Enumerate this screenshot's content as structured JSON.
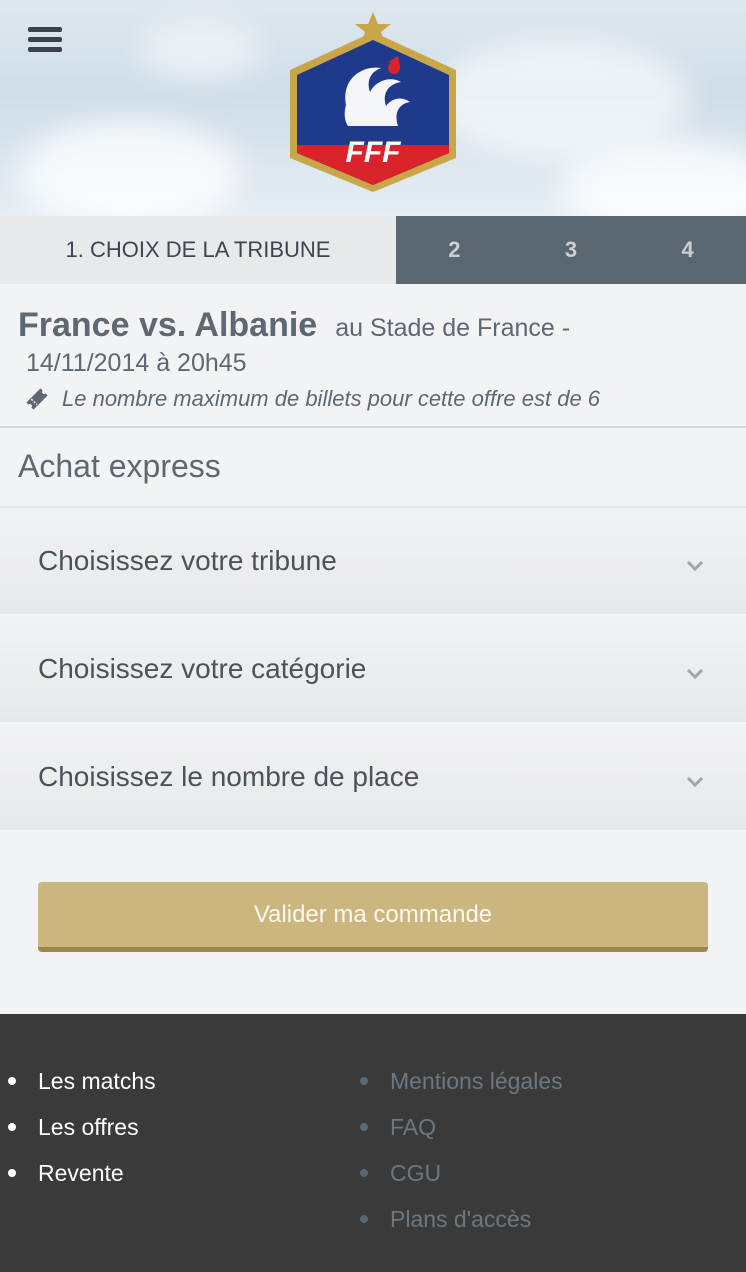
{
  "header": {
    "logo_text": "FFF"
  },
  "steps": {
    "active_label": "1. CHOIX DE LA TRIBUNE",
    "others": [
      "2",
      "3",
      "4"
    ]
  },
  "match": {
    "teams": "France vs. Albanie",
    "venue": "au  Stade de France -",
    "datetime": "14/11/2014 à 20h45",
    "note": "Le nombre maximum de billets pour cette offre est de 6"
  },
  "express": {
    "title": "Achat express",
    "dropdowns": [
      "Choisissez votre tribune",
      "Choisissez votre catégorie",
      "Choisissez le nombre de place"
    ],
    "submit_label": "Valider ma commande"
  },
  "footer": {
    "left_links": [
      "Les matchs",
      "Les offres",
      "Revente"
    ],
    "right_links": [
      "Mentions légales",
      "FAQ",
      "CGU",
      "Plans d'accès"
    ]
  },
  "colors": {
    "accent_gold": "#cbb680",
    "step_bar": "#5b6770",
    "footer_bg": "#3a3a3a"
  },
  "icons": [
    "hamburger-menu-icon",
    "fff-logo",
    "ticket-icon",
    "chevron-down-icon"
  ]
}
